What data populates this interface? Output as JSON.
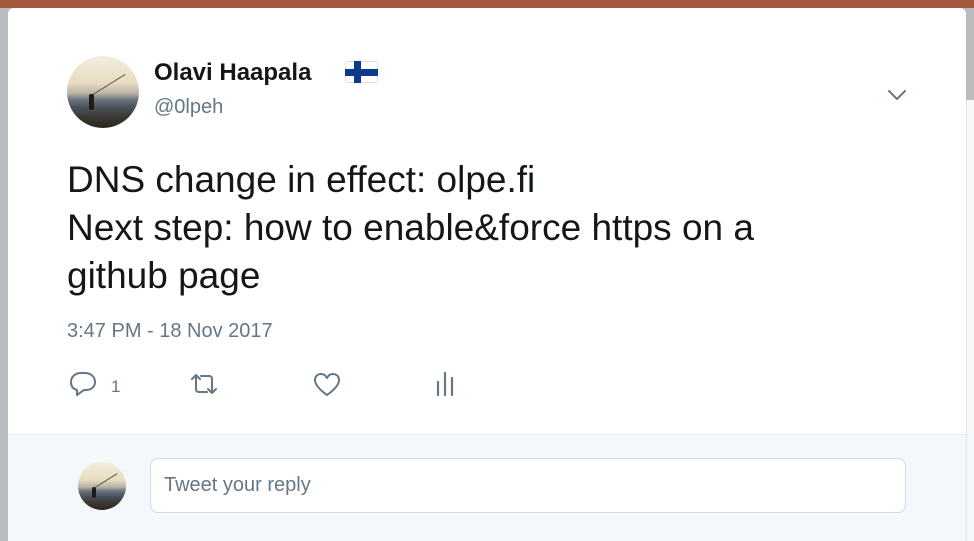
{
  "tweet": {
    "author_name": "Olavi Haapala",
    "author_handle": "@0lpeh",
    "flag_emoji": "finland-flag",
    "text_lines": [
      "DNS change in effect: olpe.fi",
      "Next step: how to enable&force https on a",
      "github page"
    ],
    "timestamp": "3:47 PM - 18 Nov 2017",
    "reply_count": "1"
  },
  "reply": {
    "placeholder": "Tweet your reply"
  },
  "colors": {
    "text_primary": "#14171a",
    "text_secondary": "#657786",
    "reply_bar_bg": "#f5f8fa",
    "input_border": "#c9dbe6"
  },
  "icons": {
    "reply": "reply-icon",
    "retweet": "retweet-icon",
    "like": "heart-icon",
    "analytics": "analytics-icon",
    "menu": "chevron-down-icon"
  }
}
